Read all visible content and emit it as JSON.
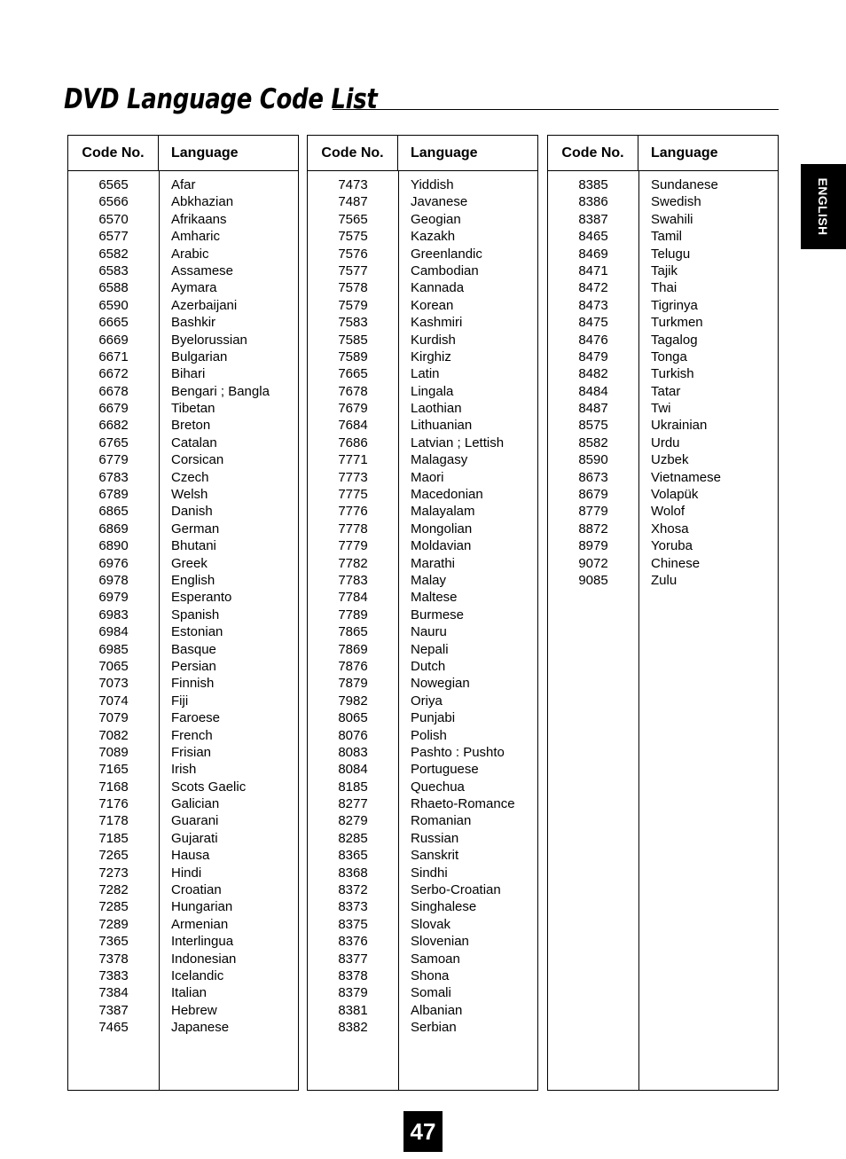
{
  "document": {
    "title": "DVD Language Code List",
    "page_number": "47",
    "side_tab_label": "ENGLISH"
  },
  "table_headers": {
    "code": "Code No.",
    "language": "Language"
  },
  "columns": [
    {
      "id": "column-1",
      "rows": [
        {
          "code": "6565",
          "language": "Afar"
        },
        {
          "code": "6566",
          "language": "Abkhazian"
        },
        {
          "code": "6570",
          "language": "Afrikaans"
        },
        {
          "code": "6577",
          "language": "Amharic"
        },
        {
          "code": "6582",
          "language": "Arabic"
        },
        {
          "code": "6583",
          "language": "Assamese"
        },
        {
          "code": "6588",
          "language": "Aymara"
        },
        {
          "code": "6590",
          "language": "Azerbaijani"
        },
        {
          "code": "6665",
          "language": "Bashkir"
        },
        {
          "code": "6669",
          "language": "Byelorussian"
        },
        {
          "code": "6671",
          "language": "Bulgarian"
        },
        {
          "code": "6672",
          "language": "Bihari"
        },
        {
          "code": "6678",
          "language": "Bengari ; Bangla"
        },
        {
          "code": "6679",
          "language": "Tibetan"
        },
        {
          "code": "6682",
          "language": "Breton"
        },
        {
          "code": "6765",
          "language": "Catalan"
        },
        {
          "code": "6779",
          "language": "Corsican"
        },
        {
          "code": "6783",
          "language": "Czech"
        },
        {
          "code": "6789",
          "language": "Welsh"
        },
        {
          "code": "6865",
          "language": "Danish"
        },
        {
          "code": "6869",
          "language": "German"
        },
        {
          "code": "6890",
          "language": "Bhutani"
        },
        {
          "code": "6976",
          "language": "Greek"
        },
        {
          "code": "6978",
          "language": "English"
        },
        {
          "code": "6979",
          "language": "Esperanto"
        },
        {
          "code": "6983",
          "language": "Spanish"
        },
        {
          "code": "6984",
          "language": "Estonian"
        },
        {
          "code": "6985",
          "language": "Basque"
        },
        {
          "code": "7065",
          "language": "Persian"
        },
        {
          "code": "7073",
          "language": "Finnish"
        },
        {
          "code": "7074",
          "language": "Fiji"
        },
        {
          "code": "7079",
          "language": "Faroese"
        },
        {
          "code": "7082",
          "language": "French"
        },
        {
          "code": "7089",
          "language": "Frisian"
        },
        {
          "code": "7165",
          "language": "Irish"
        },
        {
          "code": "7168",
          "language": "Scots Gaelic"
        },
        {
          "code": "7176",
          "language": "Galician"
        },
        {
          "code": "7178",
          "language": "Guarani"
        },
        {
          "code": "7185",
          "language": "Gujarati"
        },
        {
          "code": "7265",
          "language": "Hausa"
        },
        {
          "code": "7273",
          "language": "Hindi"
        },
        {
          "code": "7282",
          "language": "Croatian"
        },
        {
          "code": "7285",
          "language": "Hungarian"
        },
        {
          "code": "7289",
          "language": "Armenian"
        },
        {
          "code": "7365",
          "language": "Interlingua"
        },
        {
          "code": "7378",
          "language": "Indonesian"
        },
        {
          "code": "7383",
          "language": "Icelandic"
        },
        {
          "code": "7384",
          "language": "Italian"
        },
        {
          "code": "7387",
          "language": "Hebrew"
        },
        {
          "code": "7465",
          "language": "Japanese"
        }
      ]
    },
    {
      "id": "column-2",
      "rows": [
        {
          "code": "7473",
          "language": "Yiddish"
        },
        {
          "code": "7487",
          "language": "Javanese"
        },
        {
          "code": "7565",
          "language": "Geogian"
        },
        {
          "code": "7575",
          "language": "Kazakh"
        },
        {
          "code": "7576",
          "language": "Greenlandic"
        },
        {
          "code": "7577",
          "language": "Cambodian"
        },
        {
          "code": "7578",
          "language": "Kannada"
        },
        {
          "code": "7579",
          "language": "Korean"
        },
        {
          "code": "7583",
          "language": "Kashmiri"
        },
        {
          "code": "7585",
          "language": "Kurdish"
        },
        {
          "code": "7589",
          "language": "Kirghiz"
        },
        {
          "code": "7665",
          "language": "Latin"
        },
        {
          "code": "7678",
          "language": "Lingala"
        },
        {
          "code": "7679",
          "language": "Laothian"
        },
        {
          "code": "7684",
          "language": "Lithuanian"
        },
        {
          "code": "7686",
          "language": "Latvian ; Lettish"
        },
        {
          "code": "7771",
          "language": "Malagasy"
        },
        {
          "code": "7773",
          "language": "Maori"
        },
        {
          "code": "7775",
          "language": "Macedonian"
        },
        {
          "code": "7776",
          "language": "Malayalam"
        },
        {
          "code": "7778",
          "language": "Mongolian"
        },
        {
          "code": "7779",
          "language": "Moldavian"
        },
        {
          "code": "7782",
          "language": "Marathi"
        },
        {
          "code": "7783",
          "language": "Malay"
        },
        {
          "code": "7784",
          "language": "Maltese"
        },
        {
          "code": "7789",
          "language": "Burmese"
        },
        {
          "code": "7865",
          "language": "Nauru"
        },
        {
          "code": "7869",
          "language": "Nepali"
        },
        {
          "code": "7876",
          "language": "Dutch"
        },
        {
          "code": "7879",
          "language": "Nowegian"
        },
        {
          "code": "7982",
          "language": "Oriya"
        },
        {
          "code": "8065",
          "language": "Punjabi"
        },
        {
          "code": "8076",
          "language": "Polish"
        },
        {
          "code": "8083",
          "language": "Pashto : Pushto"
        },
        {
          "code": "8084",
          "language": "Portuguese"
        },
        {
          "code": "8185",
          "language": "Quechua"
        },
        {
          "code": "8277",
          "language": "Rhaeto-Romance"
        },
        {
          "code": "8279",
          "language": "Romanian"
        },
        {
          "code": "8285",
          "language": "Russian"
        },
        {
          "code": "8365",
          "language": "Sanskrit"
        },
        {
          "code": "8368",
          "language": "Sindhi"
        },
        {
          "code": "8372",
          "language": "Serbo-Croatian"
        },
        {
          "code": "8373",
          "language": "Singhalese"
        },
        {
          "code": "8375",
          "language": "Slovak"
        },
        {
          "code": "8376",
          "language": "Slovenian"
        },
        {
          "code": "8377",
          "language": "Samoan"
        },
        {
          "code": "8378",
          "language": "Shona"
        },
        {
          "code": "8379",
          "language": "Somali"
        },
        {
          "code": "8381",
          "language": "Albanian"
        },
        {
          "code": "8382",
          "language": "Serbian"
        }
      ]
    },
    {
      "id": "column-3",
      "rows": [
        {
          "code": "8385",
          "language": "Sundanese"
        },
        {
          "code": "8386",
          "language": "Swedish"
        },
        {
          "code": "8387",
          "language": "Swahili"
        },
        {
          "code": "8465",
          "language": "Tamil"
        },
        {
          "code": "8469",
          "language": "Telugu"
        },
        {
          "code": "8471",
          "language": "Tajik"
        },
        {
          "code": "8472",
          "language": "Thai"
        },
        {
          "code": "8473",
          "language": "Tigrinya"
        },
        {
          "code": "8475",
          "language": "Turkmen"
        },
        {
          "code": "8476",
          "language": "Tagalog"
        },
        {
          "code": "8479",
          "language": "Tonga"
        },
        {
          "code": "8482",
          "language": "Turkish"
        },
        {
          "code": "8484",
          "language": "Tatar"
        },
        {
          "code": "8487",
          "language": "Twi"
        },
        {
          "code": "8575",
          "language": "Ukrainian"
        },
        {
          "code": "8582",
          "language": "Urdu"
        },
        {
          "code": "8590",
          "language": "Uzbek"
        },
        {
          "code": "8673",
          "language": "Vietnamese"
        },
        {
          "code": "8679",
          "language": "Volapük"
        },
        {
          "code": "8779",
          "language": "Wolof"
        },
        {
          "code": "8872",
          "language": "Xhosa"
        },
        {
          "code": "8979",
          "language": "Yoruba"
        },
        {
          "code": "9072",
          "language": "Chinese"
        },
        {
          "code": "9085",
          "language": "Zulu"
        }
      ]
    }
  ]
}
